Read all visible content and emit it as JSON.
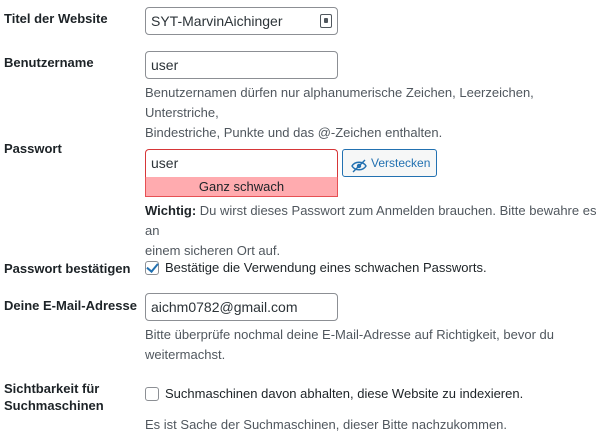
{
  "site_title": {
    "label": "Titel der Website",
    "value": "SYT-MarvinAichinger"
  },
  "username": {
    "label": "Benutzername",
    "value": "user",
    "hint_line1": "Benutzernamen dürfen nur alphanumerische Zeichen, Leerzeichen, Unterstriche,",
    "hint_line2": "Bindestriche, Punkte und das @-Zeichen enthalten."
  },
  "password": {
    "label": "Passwort",
    "value": "user",
    "strength": "Ganz schwach",
    "hide_button": "Verstecken",
    "important_prefix": "Wichtig:",
    "important_line1": " Du wirst dieses Passwort zum Anmelden brauchen. Bitte bewahre es an",
    "important_line2": "einem sicheren Ort auf."
  },
  "confirm_password": {
    "label": "Passwort bestätigen",
    "checkbox_label": "Bestätige die Verwendung eines schwachen Passworts.",
    "checked": true
  },
  "email": {
    "label": "Deine E-Mail-Adresse",
    "value": "aichm0782@gmail.com",
    "hint_line1": "Bitte überprüfe nochmal deine E-Mail-Adresse auf Richtigkeit, bevor du",
    "hint_line2": "weitermachst."
  },
  "visibility": {
    "label_line1": "Sichtbarkeit für",
    "label_line2": "Suchmaschinen",
    "checkbox_label": "Suchmaschinen davon abhalten, diese Website zu indexieren.",
    "checked": false,
    "hint": "Es ist Sache der Suchmaschinen, dieser Bitte nachzukommen."
  },
  "colors": {
    "accent": "#2271b1",
    "weak_bg": "#ffabaf",
    "weak_border": "#d63638"
  }
}
